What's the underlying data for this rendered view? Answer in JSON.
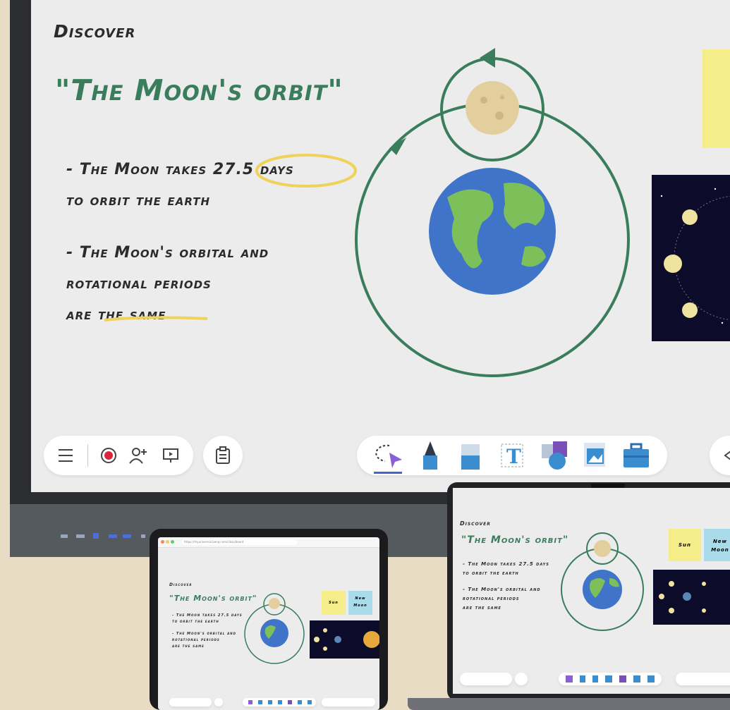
{
  "board": {
    "kicker": "Discover",
    "title": "\"The Moon's orbit\"",
    "bullet1_line1": "- The Moon takes 27.5 days",
    "bullet1_line2": "to orbit the earth",
    "bullet2_line1": "- The Moon's orbital and",
    "bullet2_line2": "rotational periods",
    "bullet2_line3": "are the same"
  },
  "tablet": {
    "url": "https://myuniversal.benq.com/class/board",
    "sticky_sun": "Sun",
    "sticky_newmoon": "New Moon"
  },
  "laptop": {
    "sticky_sun": "Sun",
    "sticky_newmoon": "New Moon"
  },
  "colors": {
    "accent_green": "#3a7d5c",
    "highlight_yellow": "#efd25a",
    "sticky_yellow": "#f5ec8a",
    "sticky_blue": "#a9dbea"
  },
  "icons": [
    "menu-icon",
    "record-icon",
    "add-user-icon",
    "present-icon",
    "clipboard-icon",
    "lasso-select-icon",
    "pen-icon",
    "eraser-icon",
    "text-icon",
    "shapes-icon",
    "image-icon",
    "toolbox-icon",
    "back-icon"
  ]
}
